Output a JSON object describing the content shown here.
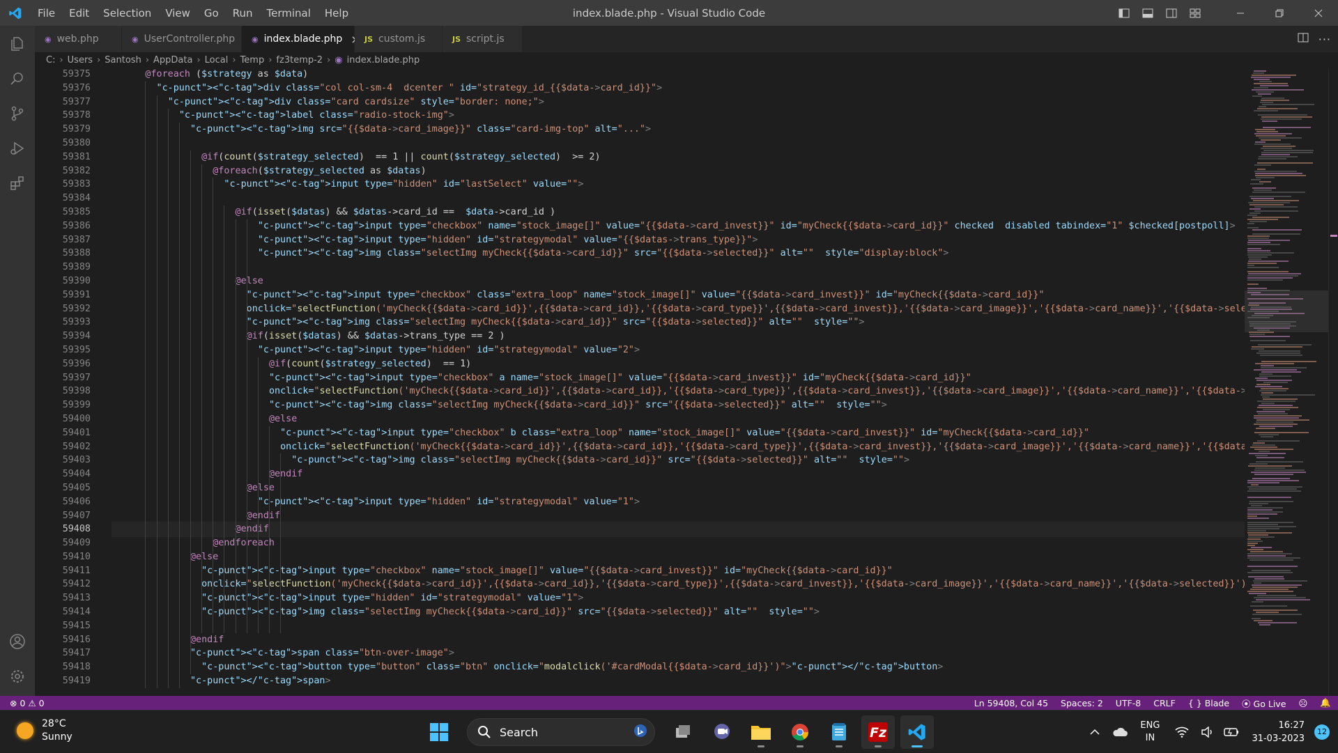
{
  "window": {
    "title": "index.blade.php - Visual Studio Code",
    "menu": [
      "File",
      "Edit",
      "Selection",
      "View",
      "Go",
      "Run",
      "Terminal",
      "Help"
    ]
  },
  "tabs": [
    {
      "label": "web.php",
      "icon": "php-icon",
      "badge": "",
      "active": false
    },
    {
      "label": "UserController.php",
      "icon": "php-icon",
      "badge": "",
      "active": false
    },
    {
      "label": "index.blade.php",
      "icon": "blade-icon",
      "badge": "",
      "active": true
    },
    {
      "label": "custom.js",
      "icon": "js-icon",
      "badge": "JS",
      "active": false
    },
    {
      "label": "script.js",
      "icon": "js-icon",
      "badge": "JS",
      "active": false
    }
  ],
  "breadcrumb": [
    "C:",
    "Users",
    "Santosh",
    "AppData",
    "Local",
    "Temp",
    "fz3temp-2",
    "index.blade.php"
  ],
  "editor": {
    "current_line": "59408",
    "lines": [
      {
        "n": "59375",
        "indent": 6,
        "text": "@foreach ($strategy as $data)"
      },
      {
        "n": "59376",
        "indent": 8,
        "text": "<div class=\"col col-sm-4  dcenter \" id=\"strategy_id_{{$data->card_id}}\">"
      },
      {
        "n": "59377",
        "indent": 10,
        "text": "<div class=\"card cardsize\" style=\"border: none;\">"
      },
      {
        "n": "59378",
        "indent": 12,
        "text": "<label class=\"radio-stock-img\">"
      },
      {
        "n": "59379",
        "indent": 14,
        "text": "<img src=\"{{$data->card_image}}\" class=\"card-img-top\" alt=\"...\">"
      },
      {
        "n": "59380",
        "indent": 0,
        "text": ""
      },
      {
        "n": "59381",
        "indent": 16,
        "text": "@if(count($strategy_selected)  == 1 || count($strategy_selected)  >= 2)"
      },
      {
        "n": "59382",
        "indent": 18,
        "text": "@foreach($strategy_selected as $datas)"
      },
      {
        "n": "59383",
        "indent": 20,
        "text": "<input type=\"hidden\" id=\"lastSelect\" value=\"\">"
      },
      {
        "n": "59384",
        "indent": 0,
        "text": ""
      },
      {
        "n": "59385",
        "indent": 22,
        "text": "@if(isset($datas) && $datas->card_id ==  $data->card_id )"
      },
      {
        "n": "59386",
        "indent": 26,
        "text": "<input type=\"checkbox\" name=\"stock_image[]\" value=\"{{$data->card_invest}}\" id=\"myCheck{{$data->card_id}}\" checked  disabled tabindex=\"1\" $checked[postpoll]>"
      },
      {
        "n": "59387",
        "indent": 26,
        "text": "<input type=\"hidden\" id=\"strategymodal\" value=\"{{$datas->trans_type}}\">"
      },
      {
        "n": "59388",
        "indent": 26,
        "text": "<img class=\"selectImg myCheck{{$data->card_id}}\" src=\"{{$data->selected}}\" alt=\"\"  style=\"display:block\">"
      },
      {
        "n": "59389",
        "indent": 0,
        "text": ""
      },
      {
        "n": "59390",
        "indent": 22,
        "text": "@else"
      },
      {
        "n": "59391",
        "indent": 24,
        "text": "<input type=\"checkbox\" class=\"extra_loop\" name=\"stock_image[]\" value=\"{{$data->card_invest}}\" id=\"myCheck{{$data->card_id}}\""
      },
      {
        "n": "59392",
        "indent": 24,
        "text": "onclick=\"selectFunction('myCheck{{$data->card_id}}',{{$data->card_id}},'{{$data->card_type}}',{{$data->card_invest}},'{{$data->card_image}}','{{$data->card_name}}','{{$data->selected}}')\" >"
      },
      {
        "n": "59393",
        "indent": 24,
        "text": "<img class=\"selectImg myCheck{{$data->card_id}}\" src=\"{{$data->selected}}\" alt=\"\"  style=\"\">"
      },
      {
        "n": "59394",
        "indent": 24,
        "text": "@if(isset($datas) && $datas->trans_type == 2 )"
      },
      {
        "n": "59395",
        "indent": 26,
        "text": "<input type=\"hidden\" id=\"strategymodal\" value=\"2\">"
      },
      {
        "n": "59396",
        "indent": 28,
        "text": "@if(count($strategy_selected)  == 1)"
      },
      {
        "n": "59397",
        "indent": 28,
        "text": "<input type=\"checkbox\" a name=\"stock_image[]\" value=\"{{$data->card_invest}}\" id=\"myCheck{{$data->card_id}}\""
      },
      {
        "n": "59398",
        "indent": 28,
        "text": "onclick=\"selectFunction('myCheck{{$data->card_id}}',{{$data->card_id}},'{{$data->card_type}}',{{$data->card_invest}},'{{$data->card_image}}','{{$data->card_name}}','{{$data->selected}}')\" >"
      },
      {
        "n": "59399",
        "indent": 28,
        "text": "<img class=\"selectImg myCheck{{$data->card_id}}\" src=\"{{$data->selected}}\" alt=\"\"  style=\"\">"
      },
      {
        "n": "59400",
        "indent": 28,
        "text": "@else"
      },
      {
        "n": "59401",
        "indent": 30,
        "text": "<input type=\"checkbox\" b class=\"extra_loop\" name=\"stock_image[]\" value=\"{{$data->card_invest}}\" id=\"myCheck{{$data->card_id}}\""
      },
      {
        "n": "59402",
        "indent": 30,
        "text": "onclick=\"selectFunction('myCheck{{$data->card_id}}',{{$data->card_id}},'{{$data->card_type}}',{{$data->card_invest}},'{{$data->card_image}}','{{$data->card_name}}','{{$data->selected}}')\" >"
      },
      {
        "n": "59403",
        "indent": 32,
        "text": "<img class=\"selectImg myCheck{{$data->card_id}}\" src=\"{{$data->selected}}\" alt=\"\"  style=\"\">"
      },
      {
        "n": "59404",
        "indent": 28,
        "text": "@endif"
      },
      {
        "n": "59405",
        "indent": 24,
        "text": "@else"
      },
      {
        "n": "59406",
        "indent": 26,
        "text": "<input type=\"hidden\" id=\"strategymodal\" value=\"1\">"
      },
      {
        "n": "59407",
        "indent": 24,
        "text": "@endif"
      },
      {
        "n": "59408",
        "indent": 22,
        "text": "@endif"
      },
      {
        "n": "59409",
        "indent": 18,
        "text": "@endforeach"
      },
      {
        "n": "59410",
        "indent": 14,
        "text": "@else"
      },
      {
        "n": "59411",
        "indent": 16,
        "text": "<input type=\"checkbox\" name=\"stock_image[]\" value=\"{{$data->card_invest}}\" id=\"myCheck{{$data->card_id}}\""
      },
      {
        "n": "59412",
        "indent": 16,
        "text": "onclick=\"selectFunction('myCheck{{$data->card_id}}',{{$data->card_id}},'{{$data->card_type}}',{{$data->card_invest}},'{{$data->card_image}}','{{$data->card_name}}','{{$data->selected}}')\" >"
      },
      {
        "n": "59413",
        "indent": 16,
        "text": "<input type=\"hidden\" id=\"strategymodal\" value=\"1\">"
      },
      {
        "n": "59414",
        "indent": 16,
        "text": "<img class=\"selectImg myCheck{{$data->card_id}}\" src=\"{{$data->selected}}\" alt=\"\"  style=\"\">"
      },
      {
        "n": "59415",
        "indent": 0,
        "text": ""
      },
      {
        "n": "59416",
        "indent": 14,
        "text": "@endif"
      },
      {
        "n": "59417",
        "indent": 14,
        "text": "<span class=\"btn-over-image\">"
      },
      {
        "n": "59418",
        "indent": 16,
        "text": "<button type=\"button\" class=\"btn\" onclick=\"modalclick('#cardModal{{$data->card_id}}')\"></button>"
      },
      {
        "n": "59419",
        "indent": 14,
        "text": "</span>"
      }
    ]
  },
  "statusbar": {
    "errors": "0",
    "warnings": "0",
    "position": "Ln 59408, Col 45",
    "spaces": "Spaces: 2",
    "encoding": "UTF-8",
    "eol": "CRLF",
    "language": "Blade",
    "golive": "Go Live"
  },
  "taskbar": {
    "temperature": "28°C",
    "weather": "Sunny",
    "search_placeholder": "Search",
    "lang_top": "ENG",
    "lang_bottom": "IN",
    "time": "16:27",
    "date": "31-03-2023",
    "notifications": "12"
  },
  "colors": {
    "statusbar": "#68217a",
    "accent": "#007acc",
    "titlebar": "#3c3c3c",
    "editor_bg": "#1e1e1e"
  }
}
